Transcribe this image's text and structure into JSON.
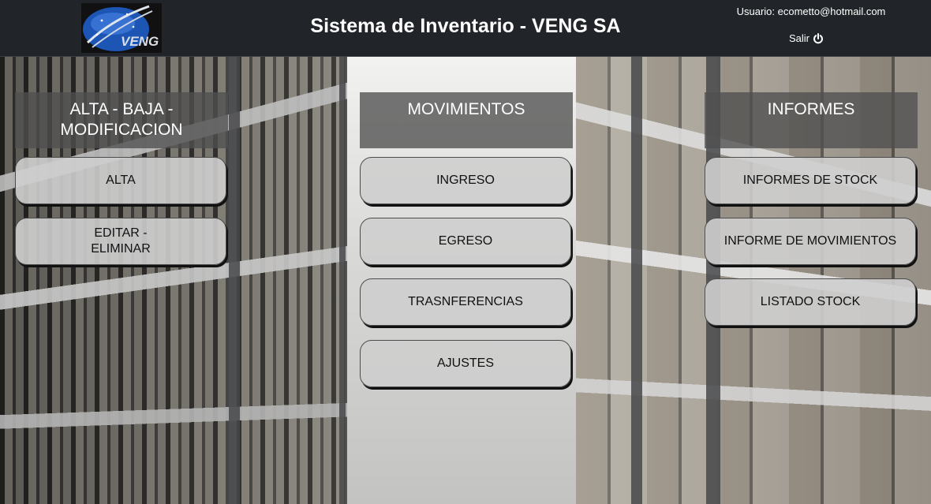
{
  "header": {
    "logo_text": "VENG",
    "title": "Sistema de Inventario - VENG SA",
    "user_label": "Usuario: ecometto@hotmail.com",
    "logout_label": "Salir",
    "logout_icon": "power-icon"
  },
  "columns": {
    "alta": {
      "title": "ALTA - BAJA - MODIFICACION",
      "buttons": [
        "ALTA",
        "EDITAR - ELIMINAR"
      ]
    },
    "movimientos": {
      "title": "MOVIMIENTOS",
      "buttons": [
        "INGRESO",
        "EGRESO",
        "TRASNFERENCIAS",
        "AJUSTES"
      ]
    },
    "informes": {
      "title": "INFORMES",
      "buttons": [
        "INFORMES DE STOCK",
        "INFORME DE MOVIMIENTOS",
        "LISTADO STOCK"
      ]
    }
  },
  "colors": {
    "header_bg": "#212529",
    "column_header_bg": "#505050",
    "button_bg": "#cecece"
  }
}
